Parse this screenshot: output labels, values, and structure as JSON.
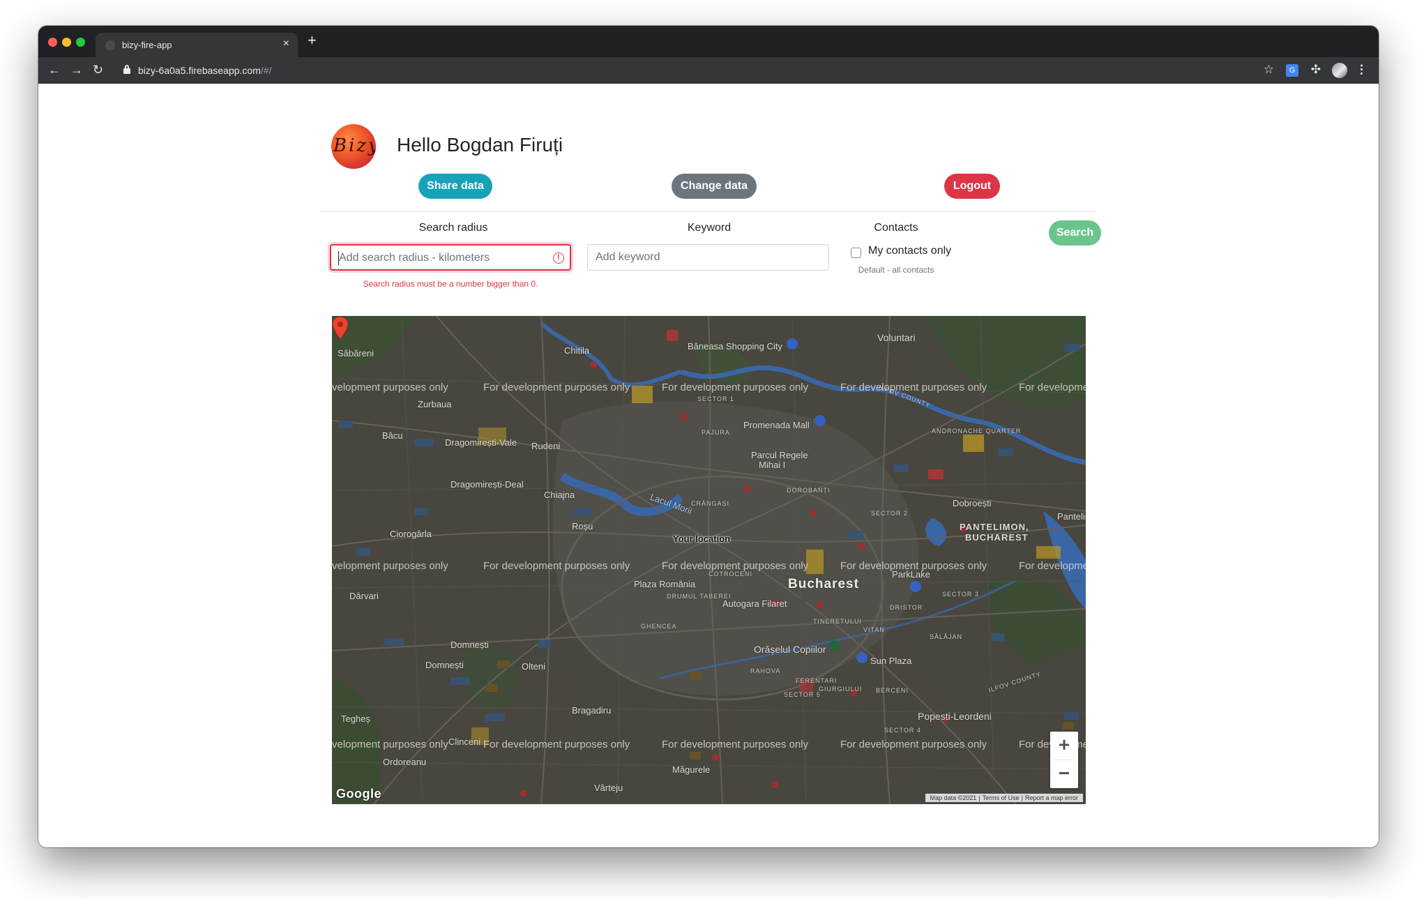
{
  "browser": {
    "tab_title": "bizy-fire-app",
    "url_host": "bizy-6a0a5.firebaseapp.com",
    "url_path": "/#/"
  },
  "header": {
    "logo_text": "Bizy",
    "greeting": "Hello Bogdan Firuți"
  },
  "actions": {
    "share_label": "Share data",
    "change_label": "Change data",
    "logout_label": "Logout"
  },
  "search_form": {
    "radius_label": "Search radius",
    "radius_placeholder": "Add search radius - kilometers",
    "radius_error": "Search radius must be a number bigger than 0.",
    "keyword_label": "Keyword",
    "keyword_placeholder": "Add keyword",
    "contacts_label": "Contacts",
    "contacts_checkbox_label": "My contacts only",
    "contacts_checked": false,
    "contacts_help": "Default - all contacts",
    "search_label": "Search"
  },
  "map": {
    "marker_label": "Your location",
    "watermark": "For development purposes only",
    "watermark_clip": "velopment purposes only",
    "watermark_right": "For developme",
    "places": {
      "sabareni": "Săbăreni",
      "chitila": "Chitila",
      "baneasa": "Băneasa Shopping City",
      "voluntari": "Voluntari",
      "zurbaua": "Zurbaua",
      "promenada": "Promenada Mall",
      "bacu": "Bâcu",
      "dragomiresti_vale": "Dragomirești-Vale",
      "rudeni": "Rudeni",
      "parcul": "Parcul Regele",
      "mihai": "Mihai I",
      "dragomiresti_deal": "Dragomirești-Deal",
      "chiajna": "Chiajna",
      "lacul_morii": "Lacul Morii",
      "dobroesti": "Dobroești",
      "pantelimon": "PANTELIMON,",
      "bucharest_caps": "BUCHAREST",
      "pantelim": "Pantelim",
      "rosu": "Roșu",
      "ciorogarla": "Ciorogârla",
      "bucharest": "Bucharest",
      "parklake": "ParkLake",
      "plaza_romania": "Plaza România",
      "autogara": "Autogara Filaret",
      "darvari": "Dârvari",
      "domnesti_top": "Domnești",
      "orasul": "Orășelul Copiilor",
      "domnesti": "Domnești",
      "olteni": "Olteni",
      "sun_plaza": "Sun Plaza",
      "bragadiru": "Bragadiru",
      "teghes": "Tegheș",
      "popesti": "Popesti-Leordeni",
      "clinceni": "Clinceni",
      "ordoreanu": "Ordoreanu",
      "magurele": "Măgurele",
      "varteju": "Vârteju",
      "sector1": "SECTOR 1",
      "pajura": "PAJURA",
      "andronache": "ANDRONACHE QUARTER",
      "dorobanti": "DOROBANȚI",
      "crangasi": "CRÂNGAȘI",
      "sector2": "SECTOR 2",
      "drumul_taberei": "DRUMUL TABEREI",
      "cotroceni": "COTROCENI",
      "ghencea": "GHENCEA",
      "tineretului": "TINERETULUI",
      "vitan": "VITAN",
      "dristor": "DRISTOR",
      "sector3": "SECTOR 3",
      "salajan": "SĂLĂJAN",
      "rahova": "RAHOVA",
      "ferentari": "FERENTARI",
      "giurgiului": "GIURGIULUI",
      "berceni": "BERCENI",
      "sector5": "SECTOR 5",
      "sector4": "SECTOR 4",
      "ilfov_county": "ILFOV COUNTY"
    },
    "google_logo": "Google",
    "attribution": [
      "Map data ©2021",
      "Terms of Use",
      "Report a map error"
    ],
    "zoom_in": "+",
    "zoom_out": "−"
  },
  "colors": {
    "primary_info": "#17a2b8",
    "secondary": "#6c757d",
    "danger": "#dc3545",
    "success_light": "#6bc48a",
    "map_base": "#4d4b45"
  }
}
